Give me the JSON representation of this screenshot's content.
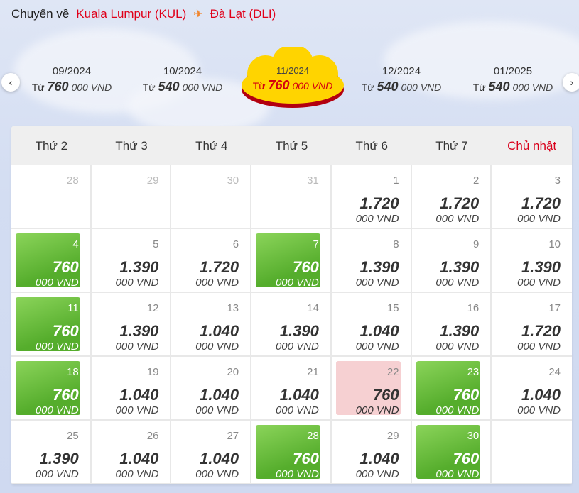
{
  "route": {
    "label": "Chuyến về",
    "origin": "Kuala Lumpur (KUL)",
    "destination": "Đà Lạt (DLI)"
  },
  "months": [
    {
      "label": "09/2024",
      "from": "Từ",
      "price": "760",
      "unit": "000 VND",
      "active": false
    },
    {
      "label": "10/2024",
      "from": "Từ",
      "price": "540",
      "unit": "000 VND",
      "active": false
    },
    {
      "label": "11/2024",
      "from": "Từ",
      "price": "760",
      "unit": "000 VND",
      "active": true
    },
    {
      "label": "12/2024",
      "from": "Từ",
      "price": "540",
      "unit": "000 VND",
      "active": false
    },
    {
      "label": "01/2025",
      "from": "Từ",
      "price": "540",
      "unit": "000 VND",
      "active": false
    }
  ],
  "weekdays": [
    "Thứ 2",
    "Thứ 3",
    "Thứ 4",
    "Thứ 5",
    "Thứ 6",
    "Thứ 7",
    "Chủ nhật"
  ],
  "unit": "000 VND",
  "days": [
    {
      "day": "28",
      "price": "",
      "state": "muted"
    },
    {
      "day": "29",
      "price": "",
      "state": "muted"
    },
    {
      "day": "30",
      "price": "",
      "state": "muted"
    },
    {
      "day": "31",
      "price": "",
      "state": "muted"
    },
    {
      "day": "1",
      "price": "1.720",
      "state": "normal"
    },
    {
      "day": "2",
      "price": "1.720",
      "state": "normal"
    },
    {
      "day": "3",
      "price": "1.720",
      "state": "normal"
    },
    {
      "day": "4",
      "price": "760",
      "state": "cheap"
    },
    {
      "day": "5",
      "price": "1.390",
      "state": "normal"
    },
    {
      "day": "6",
      "price": "1.720",
      "state": "normal"
    },
    {
      "day": "7",
      "price": "760",
      "state": "cheap"
    },
    {
      "day": "8",
      "price": "1.390",
      "state": "normal"
    },
    {
      "day": "9",
      "price": "1.390",
      "state": "normal"
    },
    {
      "day": "10",
      "price": "1.390",
      "state": "normal"
    },
    {
      "day": "11",
      "price": "760",
      "state": "cheap"
    },
    {
      "day": "12",
      "price": "1.390",
      "state": "normal"
    },
    {
      "day": "13",
      "price": "1.040",
      "state": "normal"
    },
    {
      "day": "14",
      "price": "1.390",
      "state": "normal"
    },
    {
      "day": "15",
      "price": "1.040",
      "state": "normal"
    },
    {
      "day": "16",
      "price": "1.390",
      "state": "normal"
    },
    {
      "day": "17",
      "price": "1.720",
      "state": "normal"
    },
    {
      "day": "18",
      "price": "760",
      "state": "cheap"
    },
    {
      "day": "19",
      "price": "1.040",
      "state": "normal"
    },
    {
      "day": "20",
      "price": "1.040",
      "state": "normal"
    },
    {
      "day": "21",
      "price": "1.040",
      "state": "normal"
    },
    {
      "day": "22",
      "price": "760",
      "state": "selected"
    },
    {
      "day": "23",
      "price": "760",
      "state": "cheap"
    },
    {
      "day": "24",
      "price": "1.040",
      "state": "normal"
    },
    {
      "day": "25",
      "price": "1.390",
      "state": "normal"
    },
    {
      "day": "26",
      "price": "1.040",
      "state": "normal"
    },
    {
      "day": "27",
      "price": "1.040",
      "state": "normal"
    },
    {
      "day": "28",
      "price": "760",
      "state": "cheap"
    },
    {
      "day": "29",
      "price": "1.040",
      "state": "normal"
    },
    {
      "day": "30",
      "price": "760",
      "state": "cheap"
    },
    {
      "day": "",
      "price": "",
      "state": "empty"
    }
  ],
  "colors": {
    "brand_red": "#e0001a",
    "plane_orange": "#f0852e",
    "cheap_green": "#55ad2c",
    "selected_pink": "#f6d0d2",
    "cloud_yellow": "#ffd400"
  },
  "icons": {
    "plane": "airplane-icon",
    "prev": "chevron-left-icon",
    "next": "chevron-right-icon"
  }
}
